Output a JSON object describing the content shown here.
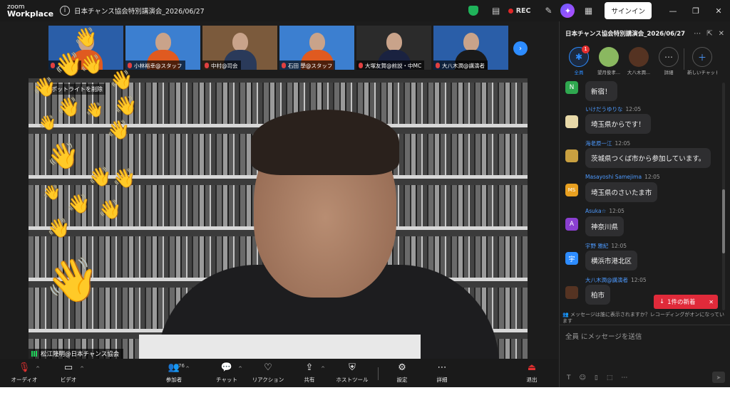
{
  "app": {
    "logo_line1": "zoom",
    "logo_line2": "Workplace",
    "meeting_title": "日本チャンス協会特別講演会_2026/06/27",
    "rec_label": "REC",
    "signin_label": "サインイン",
    "accent": "#2d8cff",
    "rec_color": "#e02828"
  },
  "thumbnails": [
    {
      "name": "スタッフ",
      "bg": "#2a5ea8",
      "shirt": "#e05a20"
    },
    {
      "name": "小林裕幸@スタッフ",
      "bg": "#3c7fd0",
      "shirt": "#e05a20"
    },
    {
      "name": "中村@司会",
      "bg": "#7b5a3c",
      "shirt": "#2a3a5a"
    },
    {
      "name": "石田 學@スタッフ",
      "bg": "#3c7fd0",
      "shirt": "#e05a20"
    },
    {
      "name": "大塚友賀@前説・中MC",
      "bg": "#2b2b2b",
      "shirt": "#1a2240"
    },
    {
      "name": "大八木潤@講演者",
      "bg": "#2a5ea8",
      "shirt": "#1a1a1a"
    }
  ],
  "speaker": {
    "name": "松江隆明@日本チャンス協会",
    "spotlight_label": "ポットライトを削除"
  },
  "toolbar": {
    "audio": "オーディオ",
    "video": "ビデオ",
    "participants": "参加者",
    "participants_count": "76",
    "chat": "チャット",
    "reactions": "リアクション",
    "share": "共有",
    "host_tools": "ホストツール",
    "settings": "設定",
    "more": "詳細",
    "leave": "退出"
  },
  "chat": {
    "title": "日本チャンス協会特別講演会_2026/06/27",
    "tabs": [
      {
        "label": "全員",
        "badge": "1"
      },
      {
        "label": "望月俊孝..."
      },
      {
        "label": "大八木潤..."
      },
      {
        "label": "詳細"
      },
      {
        "label": "新しいチャット"
      }
    ],
    "messages": [
      {
        "avatar": "N",
        "avatar_color": "#2fa84f",
        "sender": "",
        "time": "",
        "text": "新宿！"
      },
      {
        "avatar": "",
        "avatar_color": "#e8d9a8",
        "sender": "いけだうゆりな",
        "time": "12:05",
        "text": "埼玉県からです！"
      },
      {
        "avatar": "",
        "avatar_color": "#c9a040",
        "sender": "海老原一江",
        "time": "12:05",
        "text": "茨城県つくば市から参加しています。"
      },
      {
        "avatar": "MS",
        "avatar_color": "#e8a020",
        "sender": "Masayoshi Samejima",
        "time": "12:05",
        "text": "埼玉県のさいたま市"
      },
      {
        "avatar": "A",
        "avatar_color": "#8a3fd0",
        "sender": "Asuka☆",
        "time": "12:05",
        "text": "神奈川県"
      },
      {
        "avatar": "宇",
        "avatar_color": "#2d8cff",
        "sender": "宇野 雅紀",
        "time": "12:05",
        "text": "横浜市港北区"
      },
      {
        "avatar": "",
        "avatar_color": "#553322",
        "sender": "大八木潤@講演者",
        "time": "12:05",
        "text": "柏市"
      }
    ],
    "new_message_label": "1件の新着",
    "notice": "メッセージは誰に表示されますか？レコーディングがオンになっています",
    "input_placeholder": "全員 にメッセージを送信"
  }
}
